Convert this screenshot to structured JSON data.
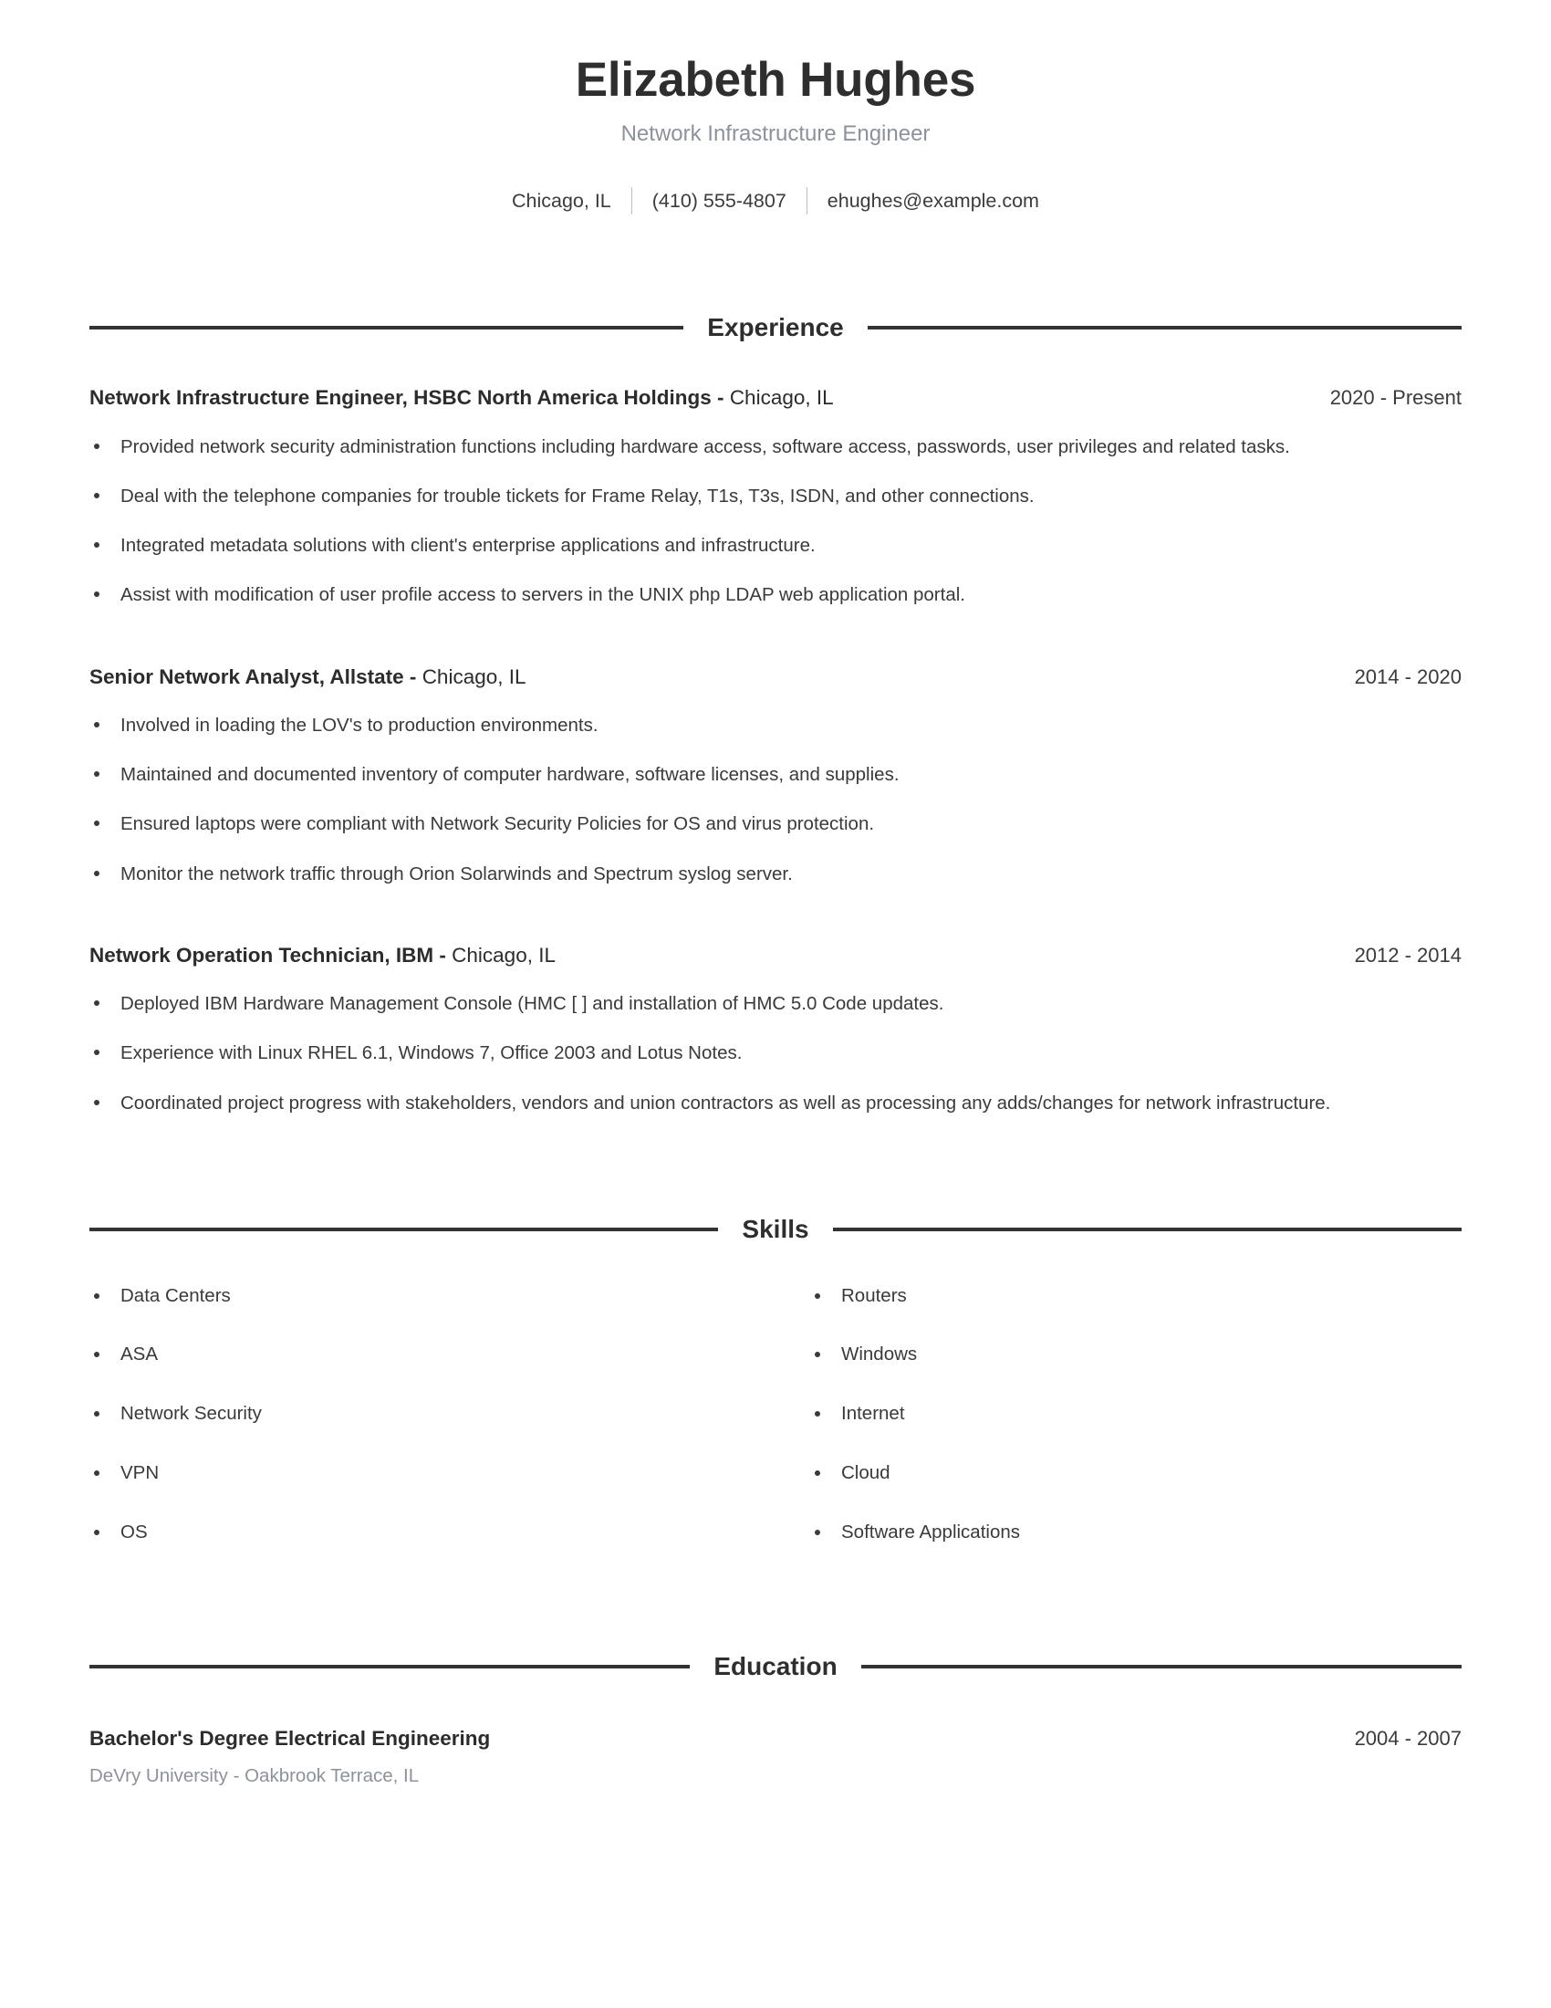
{
  "header": {
    "name": "Elizabeth Hughes",
    "title": "Network Infrastructure Engineer",
    "contact": {
      "location": "Chicago, IL",
      "phone": "(410) 555-4807",
      "email": "ehughes@example.com"
    }
  },
  "sections": {
    "experience_title": "Experience",
    "skills_title": "Skills",
    "education_title": "Education"
  },
  "experience": [
    {
      "title_bold": "Network Infrastructure Engineer, HSBC North America Holdings -",
      "title_plain": "Chicago, IL",
      "dates": "2020 - Present",
      "bullets": [
        "Provided network security administration functions including hardware access, software access, passwords, user privileges and related tasks.",
        "Deal with the telephone companies for trouble tickets for Frame Relay, T1s, T3s, ISDN, and other connections.",
        "Integrated metadata solutions with client's enterprise applications and infrastructure.",
        "Assist with modification of user profile access to servers in the UNIX php LDAP web application portal."
      ]
    },
    {
      "title_bold": "Senior Network Analyst, Allstate -",
      "title_plain": "Chicago, IL",
      "dates": "2014 - 2020",
      "bullets": [
        "Involved in loading the LOV's to production environments.",
        "Maintained and documented inventory of computer hardware, software licenses, and supplies.",
        "Ensured laptops were compliant with Network Security Policies for OS and virus protection.",
        "Monitor the network traffic through Orion Solarwinds and Spectrum syslog server."
      ]
    },
    {
      "title_bold": "Network Operation Technician, IBM -",
      "title_plain": "Chicago, IL",
      "dates": "2012 - 2014",
      "bullets": [
        "Deployed IBM Hardware Management Console (HMC [ ] and installation of HMC 5.0 Code updates.",
        "Experience with Linux RHEL 6.1, Windows 7, Office 2003 and Lotus Notes.",
        "Coordinated project progress with stakeholders, vendors and union contractors as well as processing any adds/changes for network infrastructure."
      ]
    }
  ],
  "skills": {
    "left": [
      "Data Centers",
      "ASA",
      "Network Security",
      "VPN",
      "OS"
    ],
    "right": [
      "Routers",
      "Windows",
      "Internet",
      "Cloud",
      "Software Applications"
    ]
  },
  "education": [
    {
      "degree": "Bachelor's Degree Electrical Engineering",
      "dates": "2004 - 2007",
      "school": "DeVry University - Oakbrook Terrace, IL"
    }
  ],
  "colors": {
    "text": "#333333",
    "muted": "#8d929a",
    "rule": "#333333"
  }
}
